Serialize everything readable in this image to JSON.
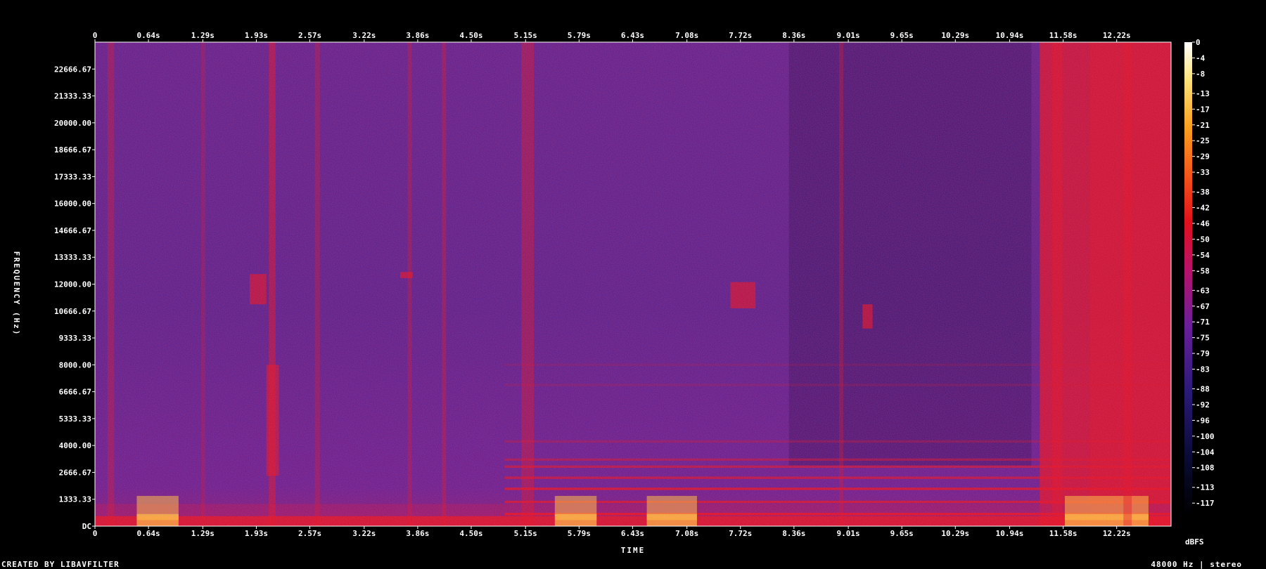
{
  "chart_data": {
    "type": "heatmap",
    "title": "",
    "xlabel": "TIME",
    "ylabel": "FREQUENCY (Hz)",
    "x_ticks": [
      "0",
      "0.64s",
      "1.29s",
      "1.93s",
      "2.57s",
      "3.22s",
      "3.86s",
      "4.50s",
      "5.15s",
      "5.79s",
      "6.43s",
      "7.08s",
      "7.72s",
      "8.36s",
      "9.01s",
      "9.65s",
      "10.29s",
      "10.94s",
      "11.58s",
      "12.22s"
    ],
    "x_tick_values": [
      0,
      0.64,
      1.29,
      1.93,
      2.57,
      3.22,
      3.86,
      4.5,
      5.15,
      5.79,
      6.43,
      7.08,
      7.72,
      8.36,
      9.01,
      9.65,
      10.29,
      10.94,
      11.58,
      12.22
    ],
    "xlim": [
      0,
      12.87
    ],
    "y_ticks": [
      "DC",
      "1333.33",
      "2666.67",
      "4000.00",
      "5333.33",
      "6666.67",
      "8000.00",
      "9333.33",
      "10666.67",
      "12000.00",
      "13333.33",
      "14666.67",
      "16000.00",
      "17333.33",
      "18666.67",
      "20000.00",
      "21333.33",
      "22666.67"
    ],
    "y_tick_values": [
      0,
      1333.33,
      2666.67,
      4000,
      5333.33,
      6666.67,
      8000,
      9333.33,
      10666.67,
      12000,
      13333.33,
      14666.67,
      16000,
      17333.33,
      18666.67,
      20000,
      21333.33,
      22666.67
    ],
    "ylim": [
      0,
      24000
    ],
    "colorbar": {
      "label": "dBFS",
      "ticks": [
        "0",
        "-4",
        "-8",
        "-13",
        "-17",
        "-21",
        "-25",
        "-29",
        "-33",
        "-38",
        "-42",
        "-46",
        "-50",
        "-54",
        "-58",
        "-63",
        "-67",
        "-71",
        "-75",
        "-79",
        "-83",
        "-88",
        "-92",
        "-96",
        "-100",
        "-104",
        "-108",
        "-113",
        "-117"
      ],
      "range": [
        -120,
        0
      ]
    },
    "colors": {
      "background": "#000000",
      "low": "#1a0a4a",
      "mid": "#5a1f9a",
      "high": "#e0101c",
      "peak": "#ffd23a"
    }
  },
  "footer": {
    "left": "CREATED BY LIBAVFILTER",
    "right": "48000 Hz | stereo"
  }
}
